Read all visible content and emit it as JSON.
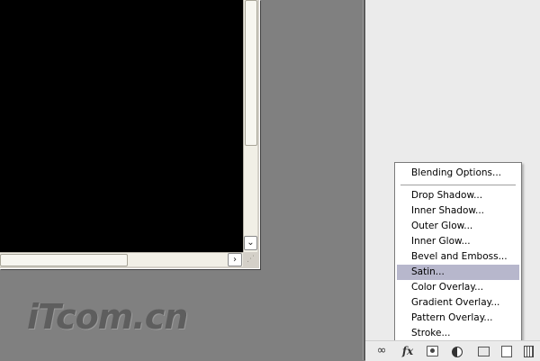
{
  "document": {
    "scroll_down_glyph": "⌄",
    "scroll_right_glyph": "›",
    "grip_glyph": "⋰"
  },
  "watermark": {
    "text": "iTcom.cn"
  },
  "fx_menu": {
    "items": [
      {
        "label": "Blending Options...",
        "selected": false
      },
      {
        "label": "Drop Shadow...",
        "selected": false
      },
      {
        "label": "Inner Shadow...",
        "selected": false
      },
      {
        "label": "Outer Glow...",
        "selected": false
      },
      {
        "label": "Inner Glow...",
        "selected": false
      },
      {
        "label": "Bevel and Emboss...",
        "selected": false
      },
      {
        "label": "Satin...",
        "selected": true
      },
      {
        "label": "Color Overlay...",
        "selected": false
      },
      {
        "label": "Gradient Overlay...",
        "selected": false
      },
      {
        "label": "Pattern Overlay...",
        "selected": false
      },
      {
        "label": "Stroke...",
        "selected": false
      }
    ]
  },
  "layers_toolbar": {
    "buttons": [
      {
        "icon": "link-layers-icon",
        "glyph": "∞"
      },
      {
        "icon": "fx-icon",
        "glyph": "fx"
      },
      {
        "icon": "layer-mask-icon",
        "glyph": ""
      },
      {
        "icon": "adjustment-layer-icon",
        "glyph": ""
      },
      {
        "icon": "new-group-icon",
        "glyph": ""
      },
      {
        "icon": "new-layer-icon",
        "glyph": ""
      },
      {
        "icon": "delete-layer-icon",
        "glyph": ""
      }
    ]
  },
  "colors": {
    "workspace": "#808080",
    "panel": "#ebebeb",
    "menu_highlight": "#b7b7cc",
    "canvas": "#000000"
  }
}
